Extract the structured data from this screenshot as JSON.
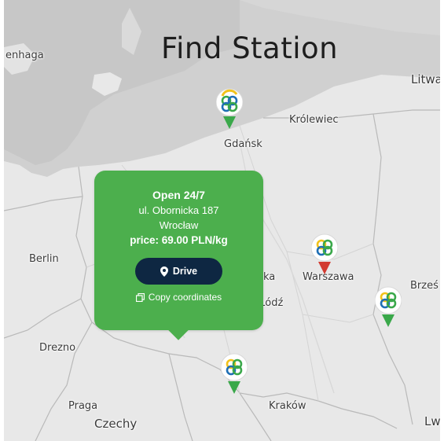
{
  "page": {
    "title": "Find Station"
  },
  "map_labels": {
    "enhaga": "enhaga",
    "litwa": "Litwa",
    "krolewiec": "Królewiec",
    "gdansk": "Gdańsk",
    "berlin": "Berlin",
    "warszawa": "Warszawa",
    "brzesc": "Brześ",
    "lodz": "Łódź",
    "ka": "ka",
    "drezno": "Drezno",
    "praga": "Praga",
    "krakow": "Kraków",
    "czechy": "Czechy",
    "lwo": "Lwo"
  },
  "popup": {
    "hours": "Open 24/7",
    "address": "ul. Obornicka 187",
    "city": "Wrocław",
    "price": "price: 69.00 PLN/kg",
    "drive_label": "Drive",
    "copy_label": "Copy coordinates"
  },
  "markers": [
    {
      "name": "gdansk",
      "status_color": "#3aa84a"
    },
    {
      "name": "warszawa",
      "status_color": "#d23a30"
    },
    {
      "name": "east",
      "status_color": "#3aa84a"
    },
    {
      "name": "south",
      "status_color": "#3aa84a"
    }
  ],
  "icons": {
    "pin": "location-pin-icon",
    "copy": "copy-icon",
    "logo": "station-logo-icon"
  }
}
